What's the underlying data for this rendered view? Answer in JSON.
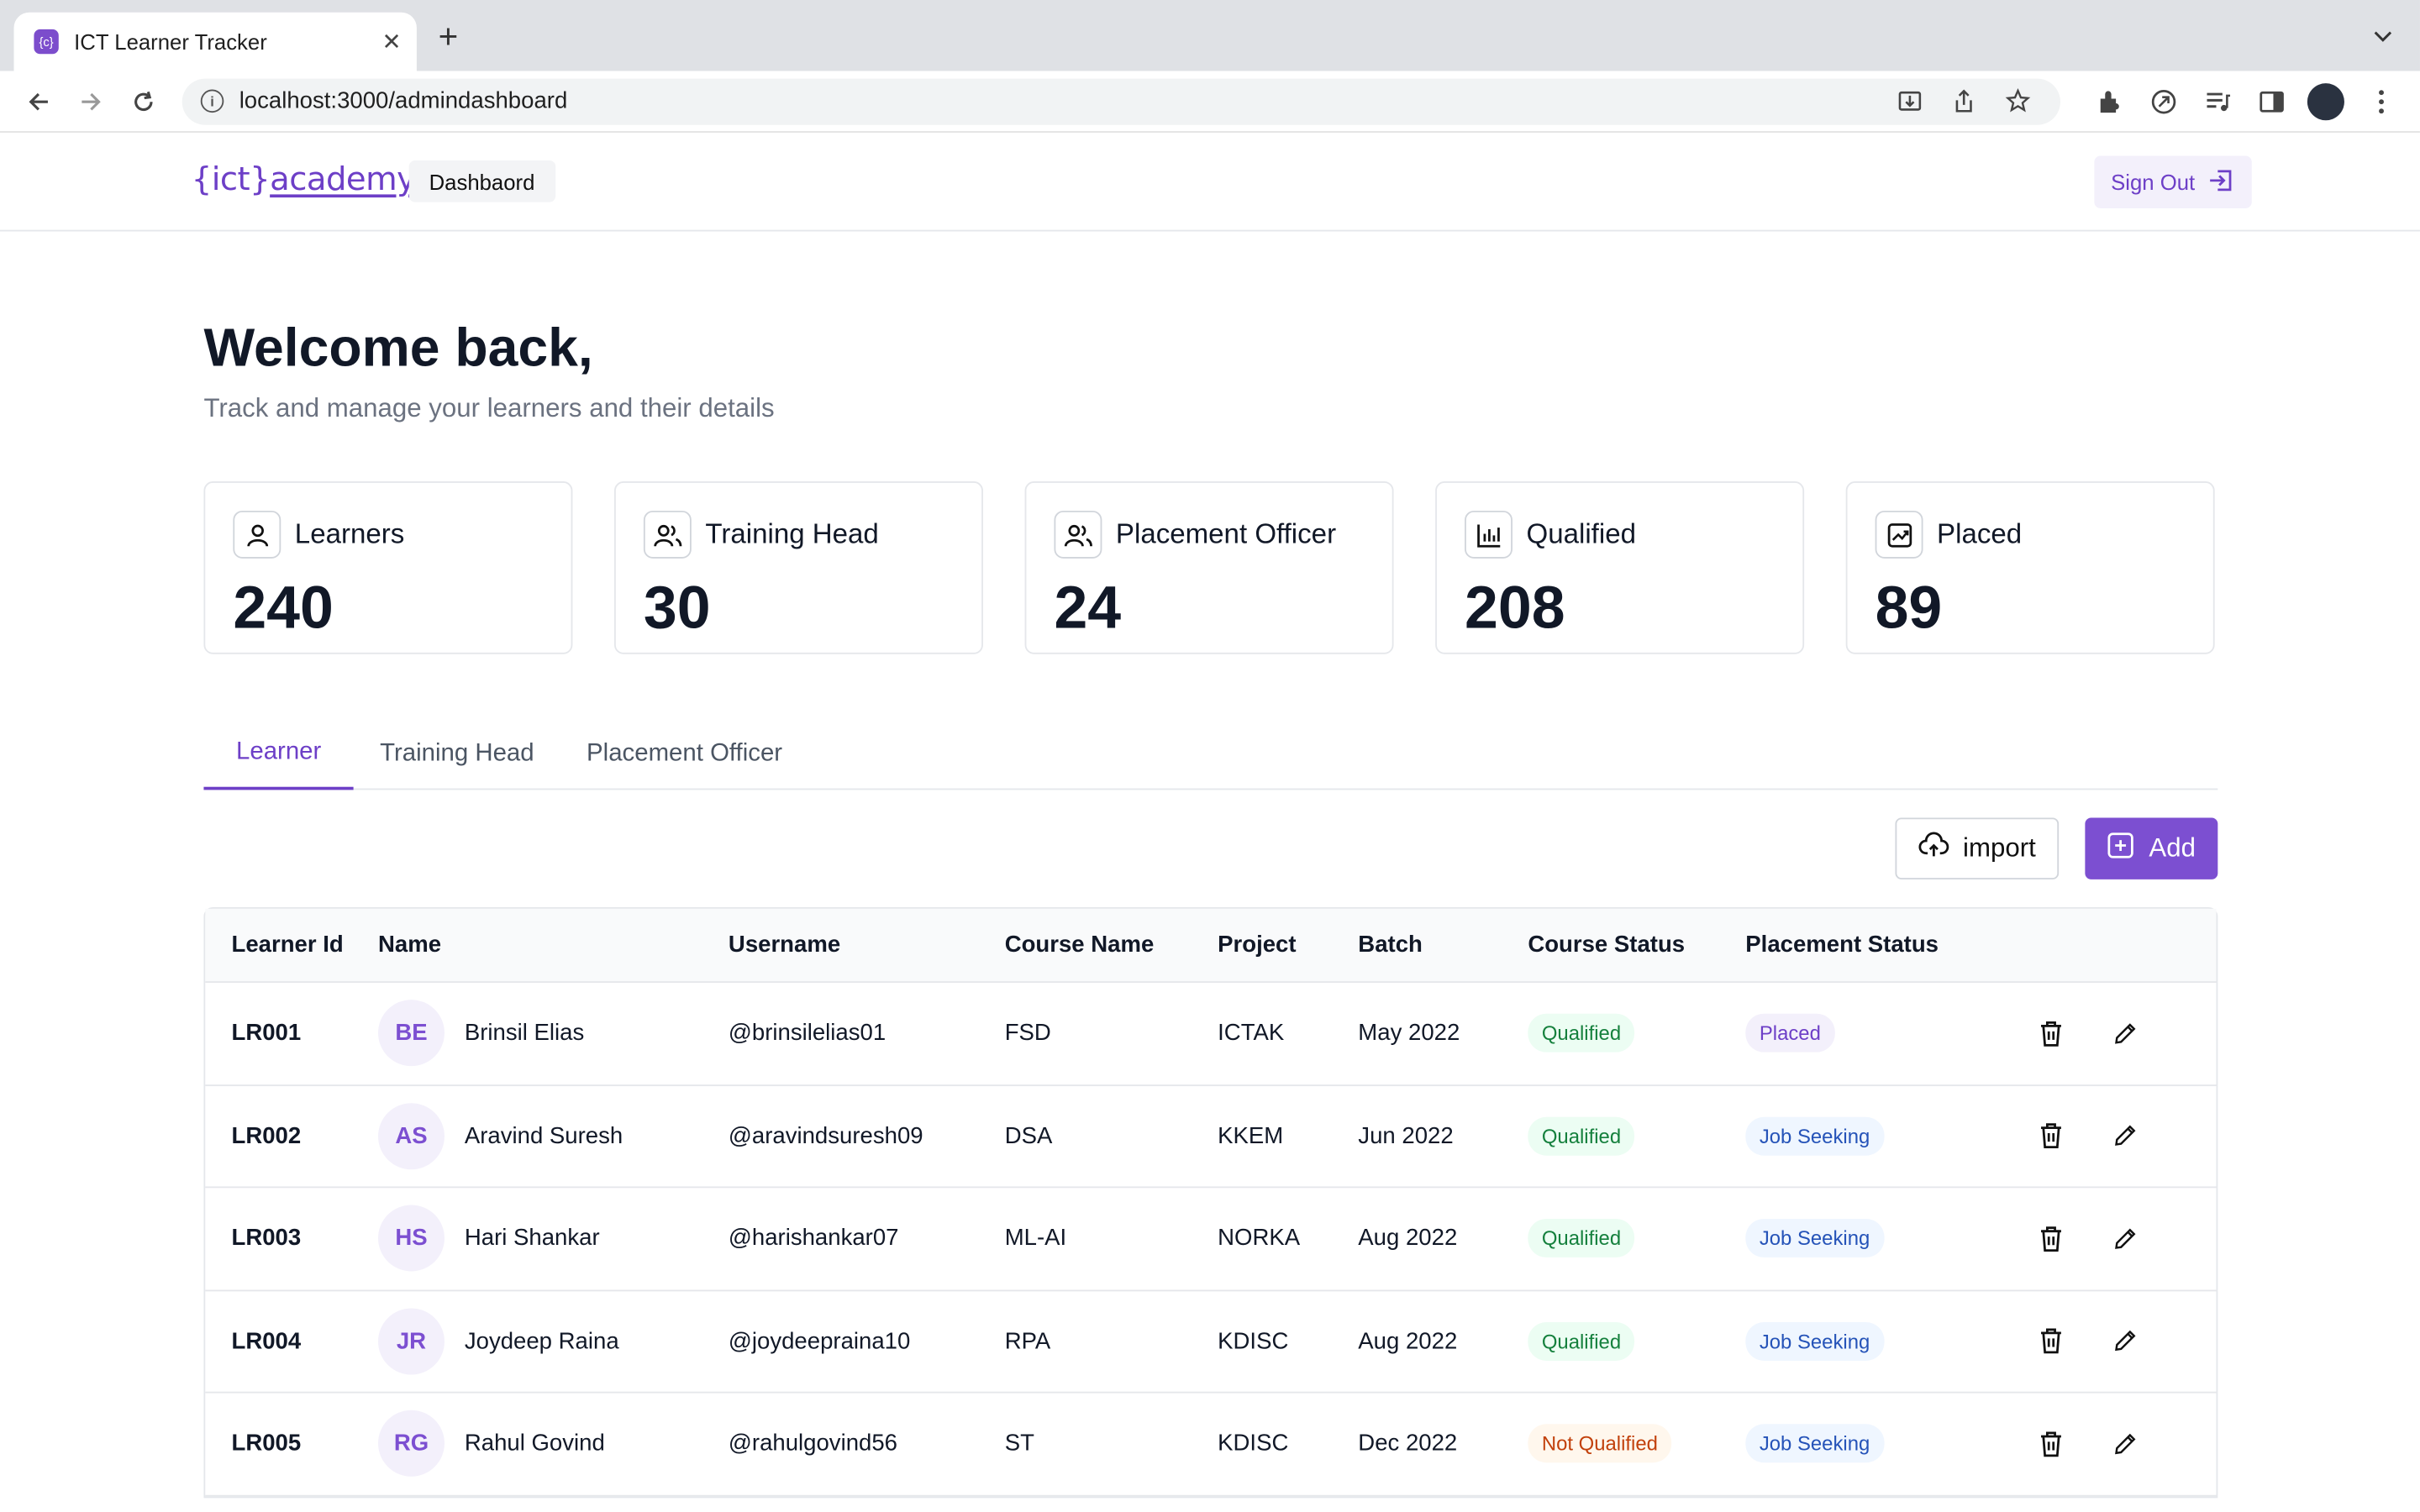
{
  "browser": {
    "tab_title": "ICT Learner Tracker",
    "favicon_text": "{c}",
    "url": "localhost:3000/admindashboard"
  },
  "header": {
    "logo_brace_open": "{ict}",
    "logo_word": "academy",
    "nav_dashboard": "Dashbaord",
    "sign_out": "Sign Out"
  },
  "welcome": {
    "title": "Welcome back,",
    "subtitle": "Track and manage your learners and their details"
  },
  "stats": [
    {
      "label": "Learners",
      "value": "240",
      "icon": "user-icon"
    },
    {
      "label": "Training Head",
      "value": "30",
      "icon": "users-icon"
    },
    {
      "label": "Placement Officer",
      "value": "24",
      "icon": "users-icon"
    },
    {
      "label": "Qualified",
      "value": "208",
      "icon": "bar-chart-icon"
    },
    {
      "label": "Placed",
      "value": "89",
      "icon": "chart-image-icon"
    }
  ],
  "tabs": [
    "Learner",
    "Training Head",
    "Placement Officer"
  ],
  "active_tab": "Learner",
  "actions": {
    "import": "import",
    "add": "Add"
  },
  "table": {
    "columns": [
      "Learner Id",
      "Name",
      "Username",
      "Course Name",
      "Project",
      "Batch",
      "Course Status",
      "Placement Status"
    ],
    "rows": [
      {
        "id": "LR001",
        "initials": "BE",
        "name": "Brinsil Elias",
        "username": "@brinsilelias01",
        "course": "FSD",
        "project": "ICTAK",
        "batch": "May 2022",
        "course_status": "Qualified",
        "placement_status": "Placed"
      },
      {
        "id": "LR002",
        "initials": "AS",
        "name": "Aravind Suresh",
        "username": "@aravindsuresh09",
        "course": "DSA",
        "project": "KKEM",
        "batch": "Jun 2022",
        "course_status": "Qualified",
        "placement_status": "Job Seeking"
      },
      {
        "id": "LR003",
        "initials": "HS",
        "name": "Hari Shankar",
        "username": "@harishankar07",
        "course": "ML-AI",
        "project": "NORKA",
        "batch": "Aug 2022",
        "course_status": "Qualified",
        "placement_status": "Job Seeking"
      },
      {
        "id": "LR004",
        "initials": "JR",
        "name": "Joydeep Raina",
        "username": "@joydeepraina10",
        "course": "RPA",
        "project": "KDISC",
        "batch": "Aug 2022",
        "course_status": "Qualified",
        "placement_status": "Job Seeking"
      },
      {
        "id": "LR005",
        "initials": "RG",
        "name": "Rahul Govind",
        "username": "@rahulgovind56",
        "course": "ST",
        "project": "KDISC",
        "batch": "Dec 2022",
        "course_status": "Not Qualified",
        "placement_status": "Job Seeking"
      }
    ]
  },
  "colors": {
    "accent": "#7c4fd1",
    "brand": "#6d3fc7",
    "qualified": "#15803d",
    "not_qualified": "#c2410c",
    "job_seeking": "#2553b8"
  }
}
